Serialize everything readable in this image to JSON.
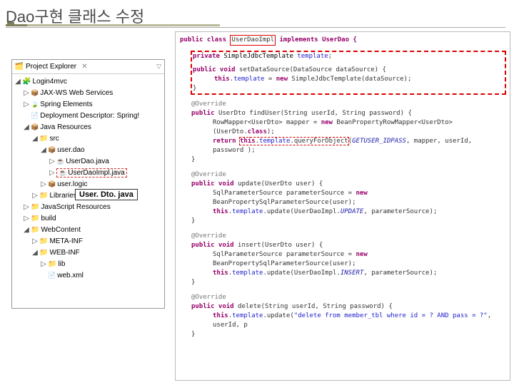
{
  "title": "Dao구현 클래스 수정",
  "explorer": {
    "tabLabel": "Project Explorer",
    "tabX": "✕",
    "project": "Login4mvc",
    "items": {
      "ws": "JAX-WS Web Services",
      "spr": "Spring Elements",
      "depl": "Deployment Descriptor: Spring!",
      "jres": "Java Resources",
      "src": "src",
      "pkgDao": "user.dao",
      "fileDao": "UserDao.java",
      "fileDaoImpl": "UserDaoImpl.java",
      "pkgLogic": "user.logic",
      "libs": "Libraries",
      "jsres": "JavaScript Resources",
      "build": "build",
      "webc": "WebContent",
      "meta": "META-INF",
      "webinf": "WEB-INF",
      "lib": "lib",
      "webxml": "web.xml"
    }
  },
  "highlightLabel": "User. Dto. java",
  "code": {
    "declPre": "public class ",
    "declName": "UserDaoImpl",
    "declPost": " implements UserDao {",
    "field": "private SimpleJdbcTemplate template;",
    "setDS1": "public void setDataSource(DataSource dataSource) {",
    "setDS2": "this.template = new SimpleJdbcTemplate(dataSource);",
    "closeBr": "}",
    "override": "@Override",
    "find1": "public UserDto findUser(String userId, String password) {",
    "find2a": "RowMapper<UserDto> mapper = new BeanPropertyRowMapper<UserDto>(UserDto.class);",
    "find2b": "return this.template.queryForObject(GETUSER_IDPASS, mapper, userId, password );",
    "upd1": "public void update(UserDto user) {",
    "upd2": "SqlParameterSource parameterSource = new BeanPropertySqlParameterSource(user);",
    "upd3pre": "this.template.update(UserDaoImpl.",
    "upd3cst": "UPDATE",
    "upd3post": ", parameterSource);",
    "ins1": "public void insert(UserDto user) {",
    "ins2": "SqlParameterSource parameterSource = new BeanPropertySqlParameterSource(user);",
    "ins3pre": "this.template.update(UserDaoImpl.",
    "ins3cst": "INSERT",
    "ins3post": ", parameterSource);",
    "del1": "public void delete(String userId, String password) {",
    "del2pre": "this.template.update(",
    "del2str": "\"delete from member_tbl where id = ? AND pass = ?\"",
    "del2post": ", userId, p"
  }
}
